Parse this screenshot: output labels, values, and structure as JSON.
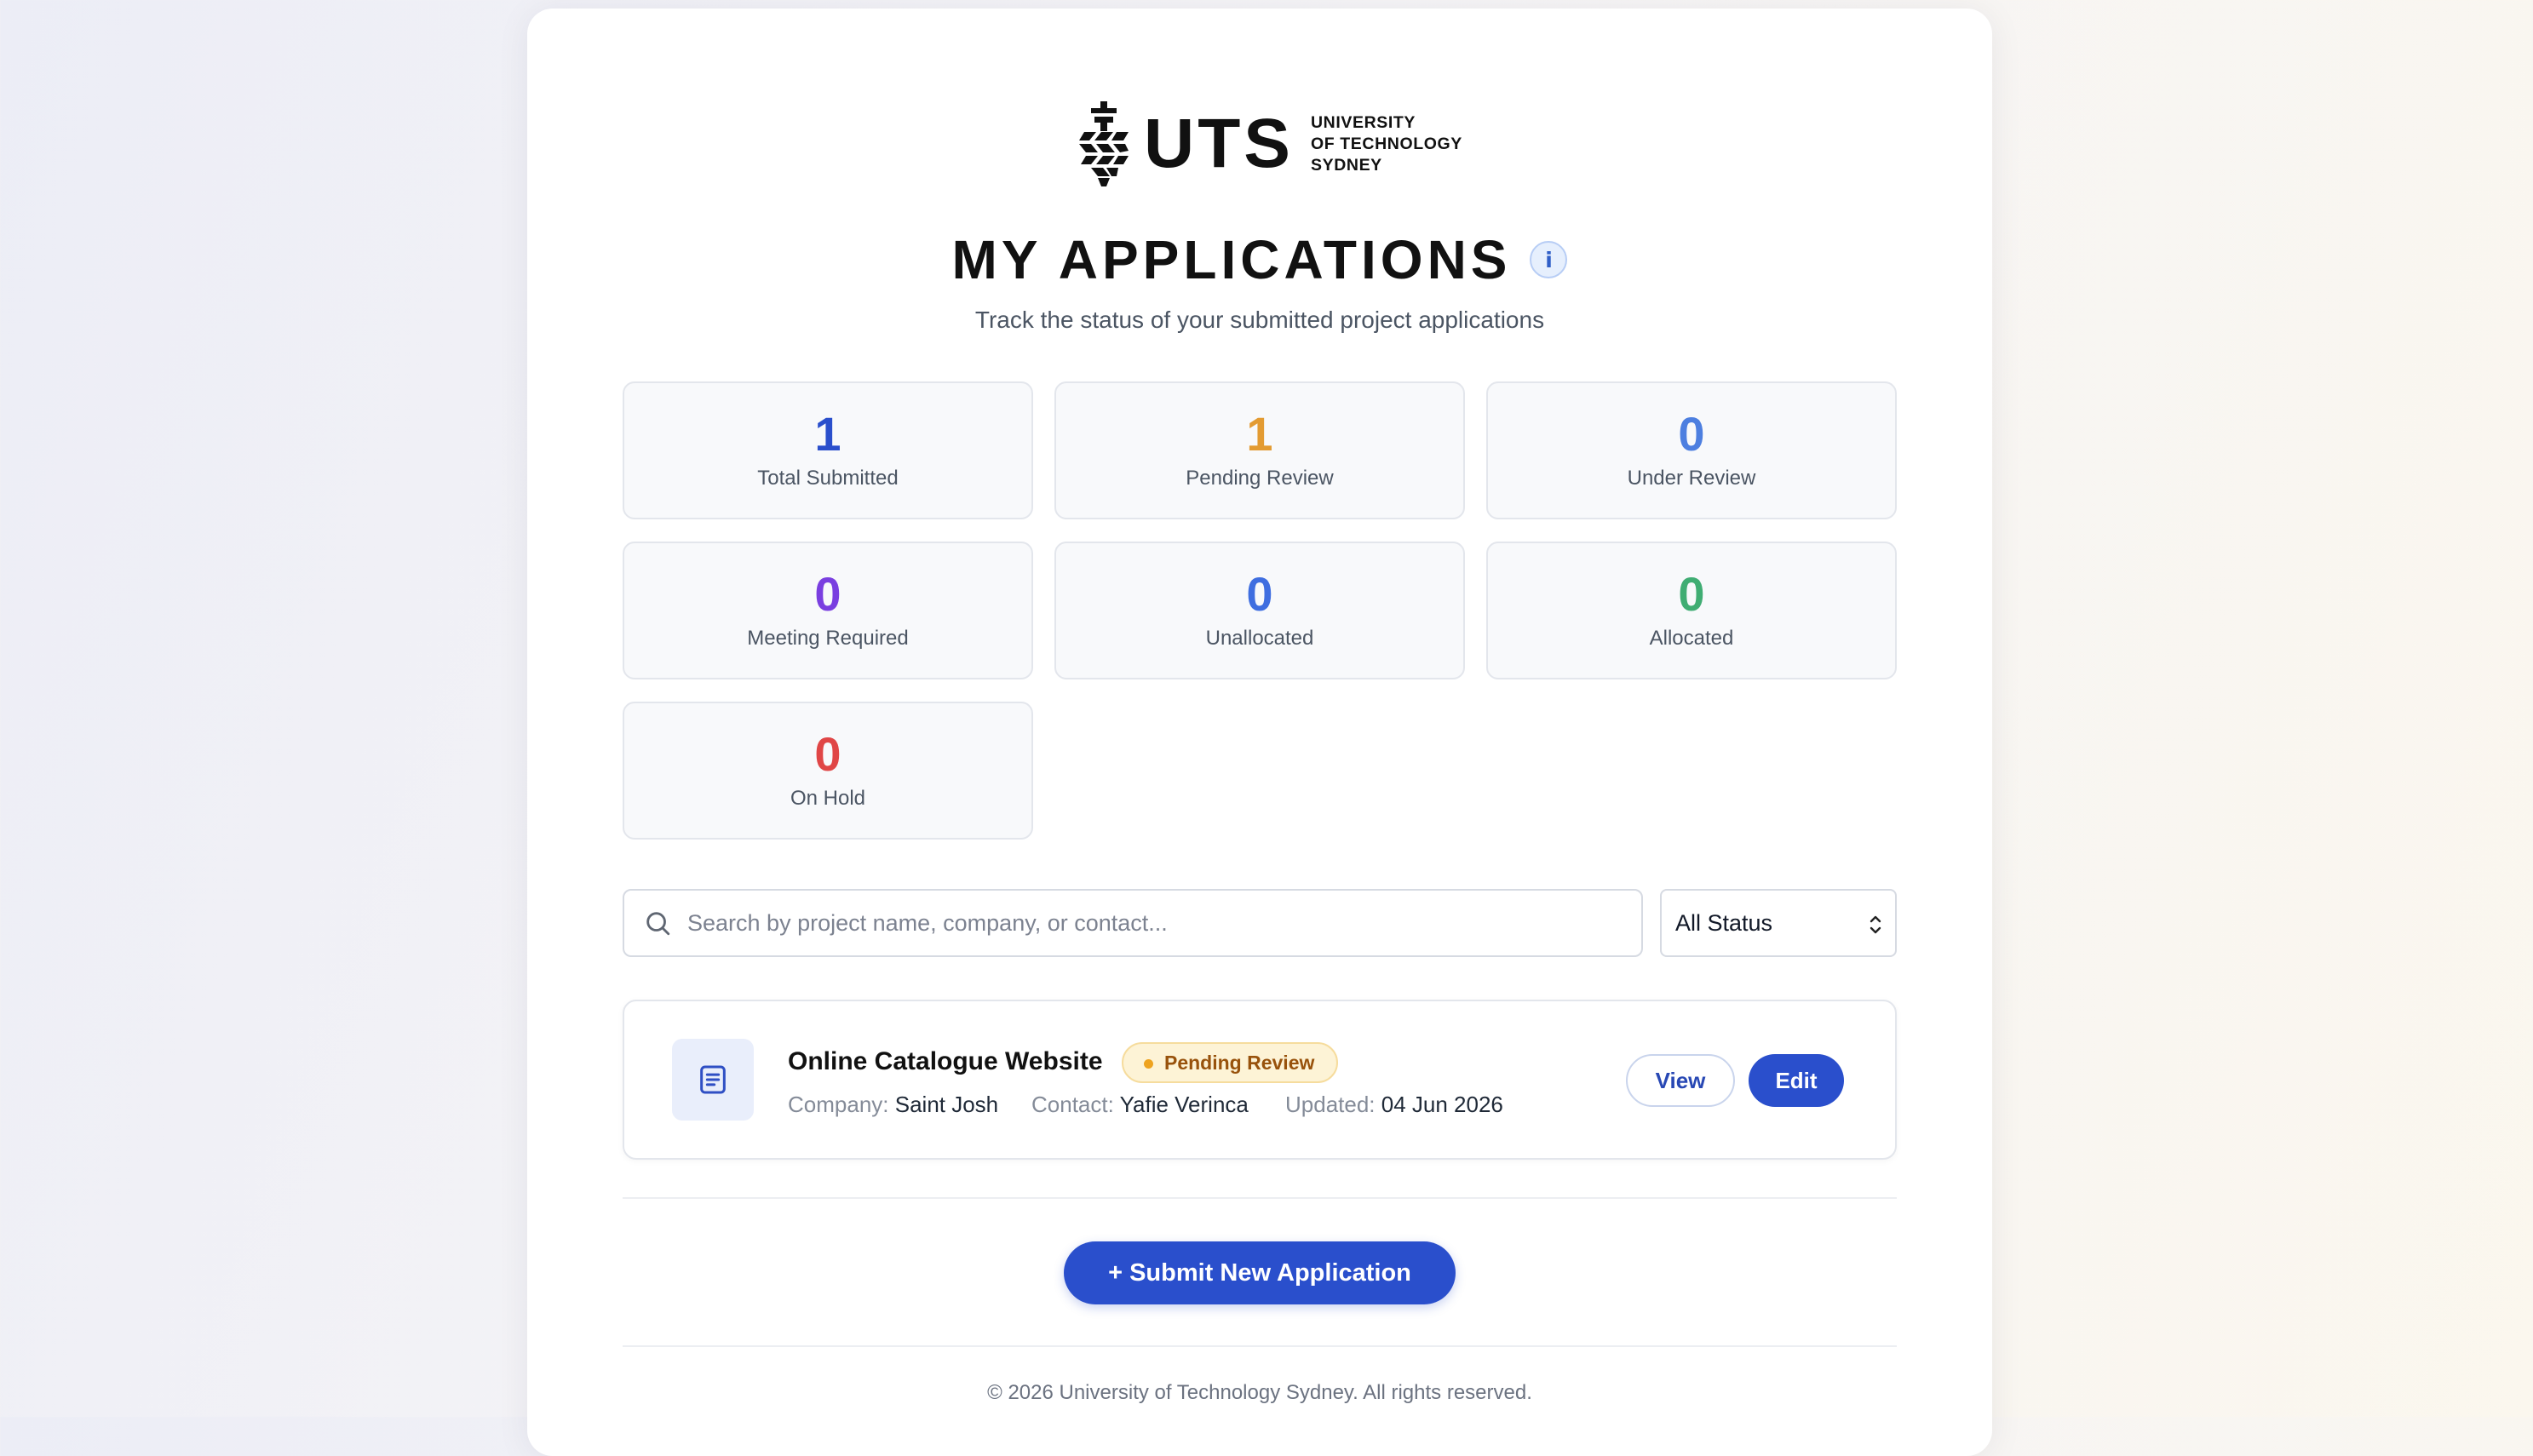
{
  "logo": {
    "wordmark": "UTS",
    "line1": "UNIVERSITY",
    "line2": "OF TECHNOLOGY",
    "line3": "SYDNEY"
  },
  "header": {
    "title": "MY APPLICATIONS",
    "info_icon": "i",
    "subtitle": "Track the status of your submitted project applications"
  },
  "stats": [
    {
      "value": "1",
      "label": "Total Submitted",
      "color": "#2a4fcc"
    },
    {
      "value": "1",
      "label": "Pending Review",
      "color": "#e39b32"
    },
    {
      "value": "0",
      "label": "Under Review",
      "color": "#4d7fe0"
    },
    {
      "value": "0",
      "label": "Meeting Required",
      "color": "#7a3fe0"
    },
    {
      "value": "0",
      "label": "Unallocated",
      "color": "#3f6ee0"
    },
    {
      "value": "0",
      "label": "Allocated",
      "color": "#40ad73"
    },
    {
      "value": "0",
      "label": "On Hold",
      "color": "#e04646"
    }
  ],
  "search": {
    "placeholder": "Search by project name, company, or contact...",
    "value": ""
  },
  "status_filter": {
    "selected": "All Status"
  },
  "applications": [
    {
      "name": "Online Catalogue Website",
      "status": "Pending Review",
      "company_label": "Company:",
      "company": "Saint Josh",
      "contact_label": "Contact:",
      "contact": "Yafie Verinca",
      "updated_label": "Updated:",
      "updated": "04 Jun 2026",
      "view_label": "View",
      "edit_label": "Edit"
    }
  ],
  "actions": {
    "submit_label": "+ Submit New Application"
  },
  "footer": {
    "text": "© 2026 University of Technology Sydney. All rights reserved."
  },
  "icons": {
    "logo": "uts-logo-icon",
    "info": "info-icon",
    "search": "search-icon",
    "select": "updown-chevron-icon",
    "document": "document-icon"
  }
}
